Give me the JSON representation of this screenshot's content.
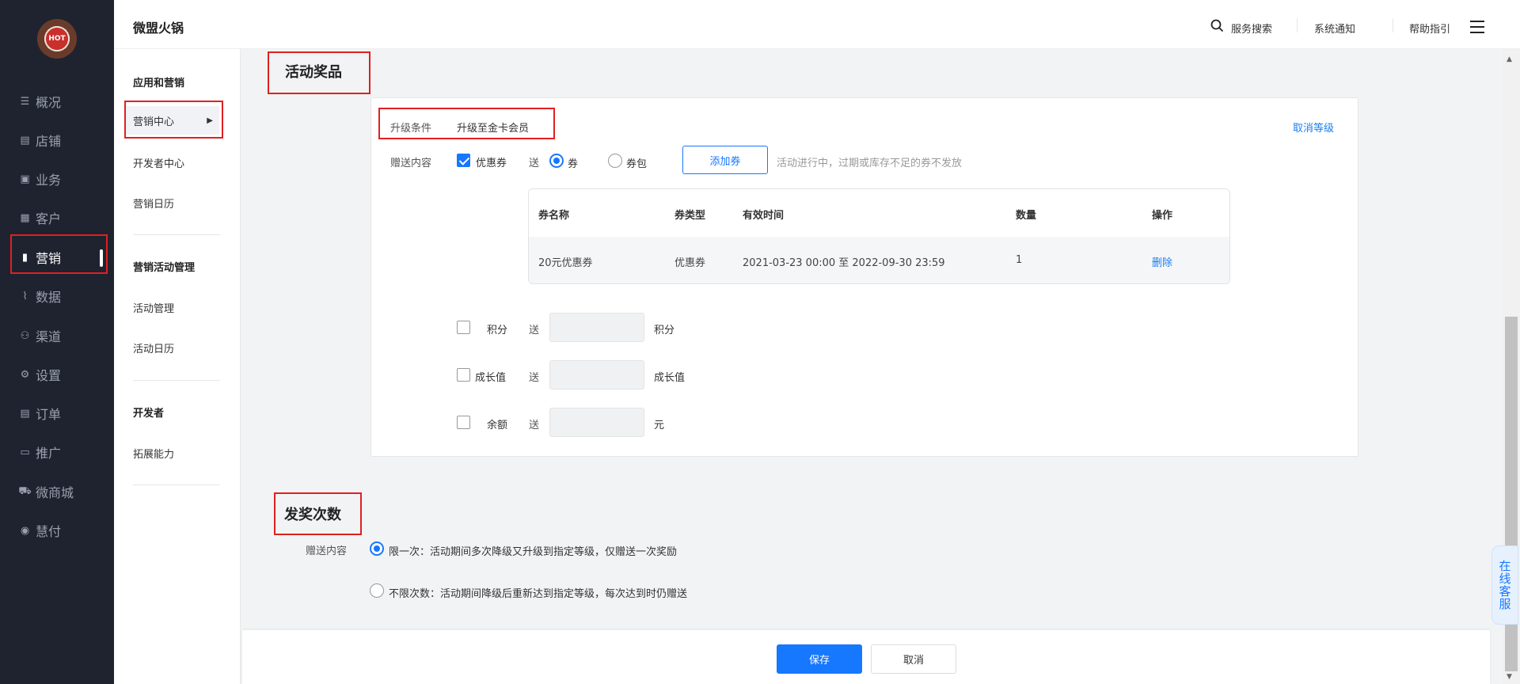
{
  "app": {
    "logo_text": "HOT",
    "brand": "微盟火锅"
  },
  "header": {
    "search": "服务搜索",
    "notice": "系统通知",
    "help": "帮助指引"
  },
  "sidebar": {
    "items": [
      {
        "label": "概况",
        "icon": "overview-icon"
      },
      {
        "label": "店铺",
        "icon": "shop-icon"
      },
      {
        "label": "业务",
        "icon": "business-icon"
      },
      {
        "label": "客户",
        "icon": "customer-icon"
      },
      {
        "label": "营销",
        "icon": "marketing-icon"
      },
      {
        "label": "数据",
        "icon": "data-icon"
      },
      {
        "label": "渠道",
        "icon": "channel-icon"
      },
      {
        "label": "设置",
        "icon": "settings-icon"
      },
      {
        "label": "订单",
        "icon": "order-icon"
      },
      {
        "label": "推广",
        "icon": "promotion-icon"
      },
      {
        "label": "微商城",
        "icon": "mall-icon"
      },
      {
        "label": "慧付",
        "icon": "pay-icon"
      }
    ]
  },
  "submenu": {
    "group1": "应用和营销",
    "item_marketing_center": "营销中心",
    "item_developer_center": "开发者中心",
    "item_marketing_calendar": "营销日历",
    "group2": "营销活动管理",
    "item_activity_manage": "活动管理",
    "item_activity_calendar": "活动日历",
    "group3": "开发者",
    "item_extend": "拓展能力"
  },
  "prize": {
    "title": "活动奖品",
    "upgrade_label": "升级条件",
    "upgrade_value": "升级至金卡会员",
    "cancel_level": "取消等级",
    "gift_label": "赠送内容",
    "coupon_check": "优惠券",
    "send": "送",
    "radio_coupon": "券",
    "radio_pack": "券包",
    "add_coupon": "添加券",
    "coupon_hint": "活动进行中，过期或库存不足的券不发放",
    "table": {
      "headers": [
        "券名称",
        "券类型",
        "有效时间",
        "数量",
        "操作"
      ],
      "rows": [
        {
          "name": "20元优惠券",
          "type": "优惠券",
          "time": "2021-03-23 00:00 至 2022-09-30 23:59",
          "qty": "1",
          "action": "删除"
        }
      ]
    },
    "points_label": "积分",
    "points_unit": "积分",
    "growth_label": "成长值",
    "growth_unit": "成长值",
    "balance_label": "余额",
    "balance_unit": "元"
  },
  "times": {
    "title": "发奖次数",
    "gift_label": "赠送内容",
    "option_once": "限一次：活动期间多次降级又升级到指定等级，仅赠送一次奖励",
    "option_unlimited": "不限次数：活动期间降级后重新达到指定等级，每次达到时仍赠送"
  },
  "actions": {
    "save": "保存",
    "cancel": "取消"
  },
  "float_service": "在线客服",
  "colors": {
    "sidebar_bg": "#1f2330",
    "primary": "#1677ff",
    "highlight": "#e02020"
  }
}
